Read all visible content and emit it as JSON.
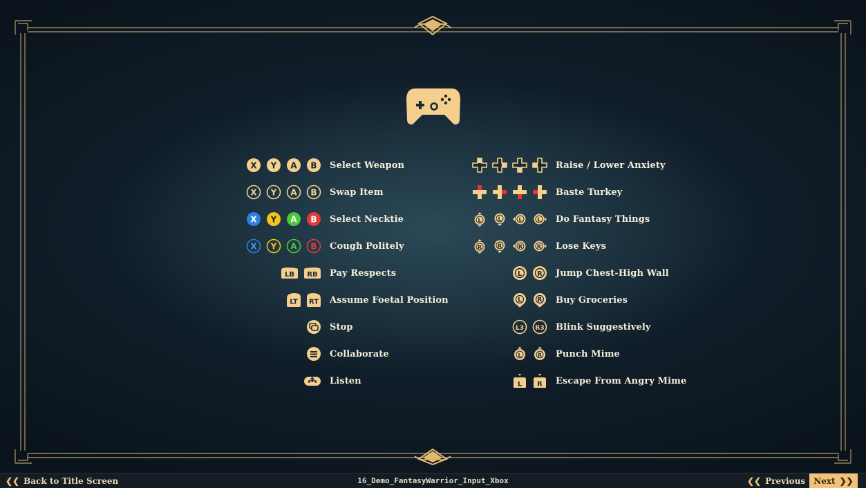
{
  "left_controls": [
    {
      "label": "Select Weapon",
      "icons": [
        "X",
        "Y",
        "A",
        "B"
      ],
      "style": "filled"
    },
    {
      "label": "Swap Item",
      "icons": [
        "X",
        "Y",
        "A",
        "B"
      ],
      "style": "outline"
    },
    {
      "label": "Select Necktie",
      "icons": [
        "X",
        "Y",
        "A",
        "B"
      ],
      "style": "color-filled"
    },
    {
      "label": "Cough Politely",
      "icons": [
        "X",
        "Y",
        "A",
        "B"
      ],
      "style": "color-outline"
    },
    {
      "label": "Pay Respects",
      "icons": [
        "LB",
        "RB"
      ],
      "style": "bumper"
    },
    {
      "label": "Assume Foetal Position",
      "icons": [
        "LT",
        "RT"
      ],
      "style": "trigger"
    },
    {
      "label": "Stop",
      "icons": [
        "view"
      ],
      "style": "view"
    },
    {
      "label": "Collaborate",
      "icons": [
        "menu"
      ],
      "style": "menu"
    },
    {
      "label": "Listen",
      "icons": [
        "share"
      ],
      "style": "share"
    }
  ],
  "right_controls": [
    {
      "label": "Raise / Lower Anxiety",
      "icons": [
        "dpad-up",
        "dpad-right",
        "dpad-down",
        "dpad-left"
      ],
      "style": "dpad-outline"
    },
    {
      "label": "Baste Turkey",
      "icons": [
        "dpad-up",
        "dpad-right",
        "dpad-down",
        "dpad-left"
      ],
      "style": "dpad-red"
    },
    {
      "label": "Do Fantasy Things",
      "icons": [
        "L",
        "L",
        "L",
        "L"
      ],
      "style": "stick-dir"
    },
    {
      "label": "Lose Keys",
      "icons": [
        "R",
        "R",
        "R",
        "R"
      ],
      "style": "stick-dir"
    },
    {
      "label": "Jump Chest-High Wall",
      "icons": [
        "L",
        "R"
      ],
      "style": "stick"
    },
    {
      "label": "Buy Groceries",
      "icons": [
        "L",
        "R"
      ],
      "style": "stick-press"
    },
    {
      "label": "Blink Suggestively",
      "icons": [
        "L3",
        "R3"
      ],
      "style": "stick-click"
    },
    {
      "label": "Punch Mime",
      "icons": [
        "L",
        "R"
      ],
      "style": "stick-updown"
    },
    {
      "label": "Escape From Angry Mime",
      "icons": [
        "L",
        "R"
      ],
      "style": "trigger-down"
    }
  ],
  "bottom_bar": {
    "back_label": "Back to Title Screen",
    "scene_name": "16_Demo_FantasyWarrior_Input_Xbox",
    "previous_label": "Previous",
    "next_label": "Next"
  },
  "colors": {
    "accent": "#f2c27a",
    "icon_fill": "#f5cf8e",
    "xbox_x": "#2d7fe0",
    "xbox_y": "#f5c518",
    "xbox_a": "#4cc93a",
    "xbox_b": "#e23b3b",
    "dpad_red": "#e8342d"
  }
}
